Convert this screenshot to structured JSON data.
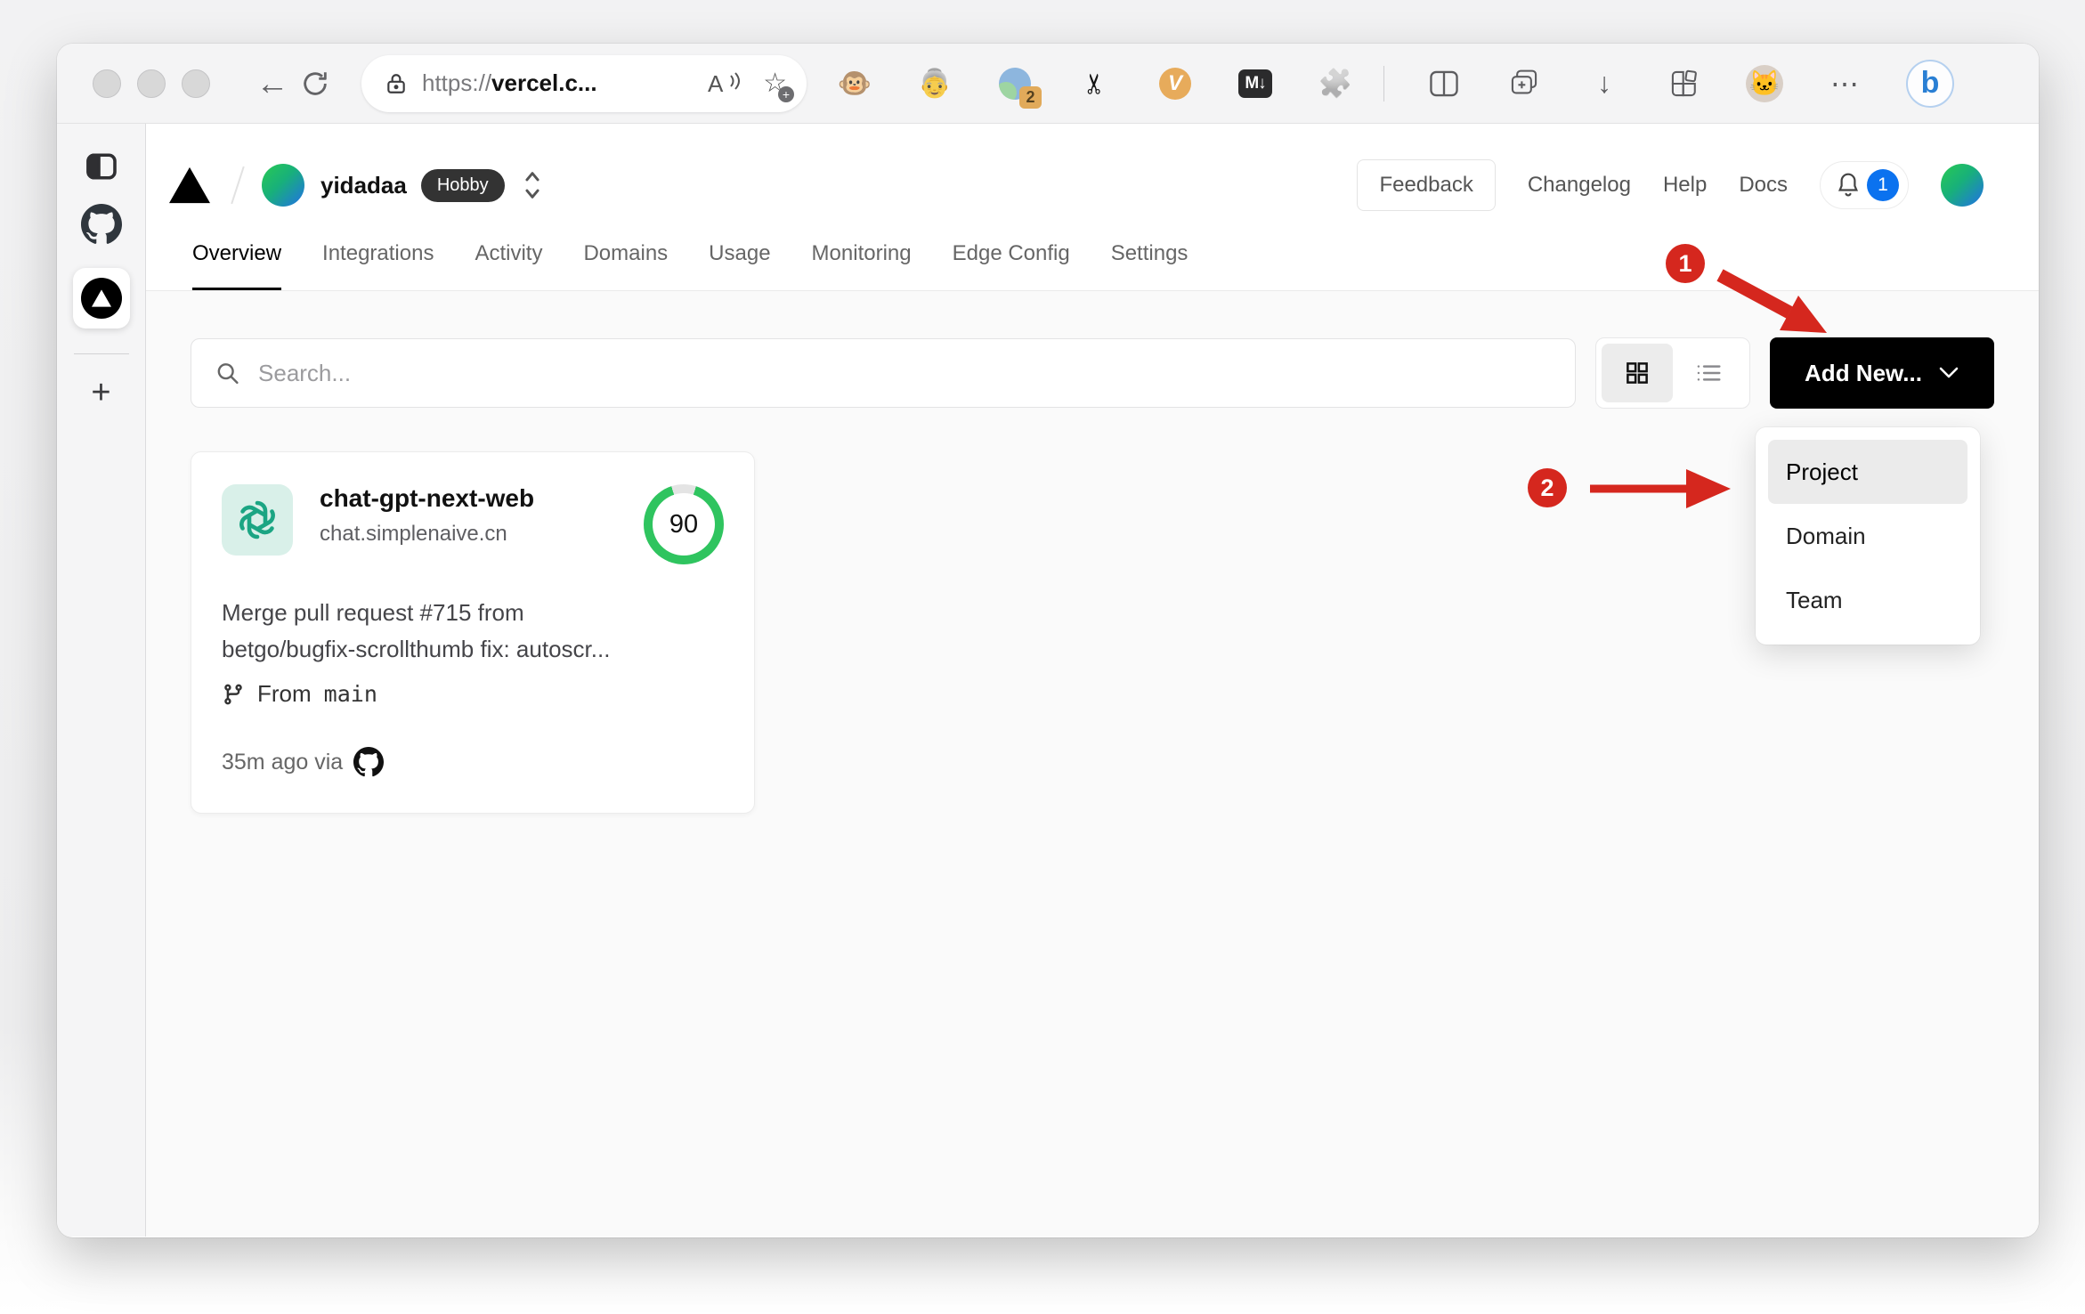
{
  "icons": {
    "back": "←",
    "download": "↓",
    "dots": "⋯",
    "scissors": "✂",
    "monkey": "🐵",
    "person": "👵",
    "puzzle": "🧩",
    "cat": "🐱",
    "plus_tab": "+",
    "markdown_ext": "M↓",
    "v_ext": "V",
    "bing": "b",
    "readaloud": "A",
    "ext_badge": "2",
    "star": "☆",
    "star_plus": "+"
  },
  "browser": {
    "url_scheme": "https://",
    "url_host": "vercel.c..."
  },
  "vercel": {
    "header": {
      "team": "yidadaa",
      "plan": "Hobby",
      "feedback": "Feedback",
      "link_changelog": "Changelog",
      "link_help": "Help",
      "link_docs": "Docs",
      "notif_count": "1"
    },
    "tabs": [
      {
        "label": "Overview"
      },
      {
        "label": "Integrations"
      },
      {
        "label": "Activity"
      },
      {
        "label": "Domains"
      },
      {
        "label": "Usage"
      },
      {
        "label": "Monitoring"
      },
      {
        "label": "Edge Config"
      },
      {
        "label": "Settings"
      }
    ],
    "controls": {
      "search_placeholder": "Search...",
      "add_new": "Add New..."
    },
    "menu": {
      "item_project": "Project",
      "item_domain": "Domain",
      "item_team": "Team"
    },
    "card": {
      "name": "chat-gpt-next-web",
      "domain": "chat.simplenaive.cn",
      "score": "90",
      "commit_line1": "Merge pull request #715 from",
      "commit_line2": "betgo/bugfix-scrollthumb fix: autoscr...",
      "branch_prefix": "From",
      "branch": "main",
      "meta": "35m ago via"
    }
  },
  "annotations": {
    "step1": "1",
    "step2": "2"
  },
  "colors": {
    "annotation_red": "#d5271e",
    "notif_blue": "#0b72ef",
    "gauge_green": "#2fc45f"
  }
}
